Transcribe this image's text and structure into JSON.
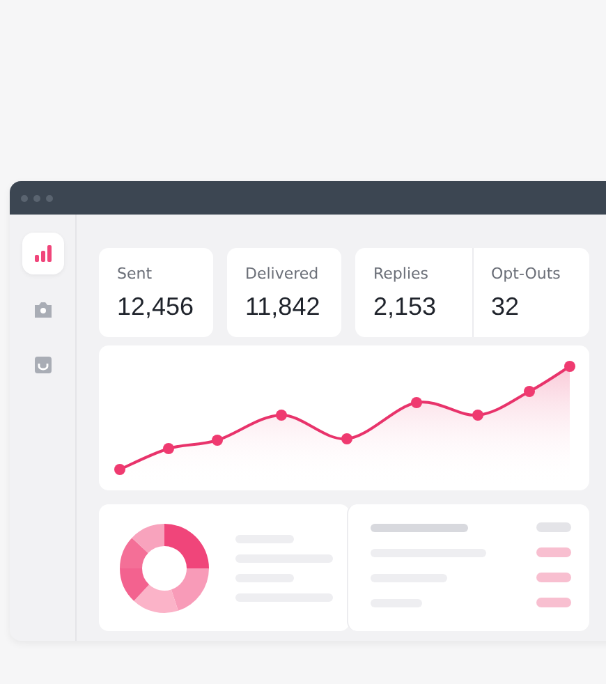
{
  "sidebar": {
    "items": [
      {
        "selected": true
      },
      {
        "selected": false
      },
      {
        "selected": false
      }
    ]
  },
  "stat_cards": [
    {
      "metrics": [
        {
          "label": "Sent",
          "value": "12,456"
        }
      ]
    },
    {
      "metrics": [
        {
          "label": "Delivered",
          "value": "11,842"
        }
      ]
    },
    {
      "metrics": [
        {
          "label": "Replies",
          "value": "2,153"
        },
        {
          "label": "Opt-Outs",
          "value": "32"
        }
      ]
    }
  ]
}
